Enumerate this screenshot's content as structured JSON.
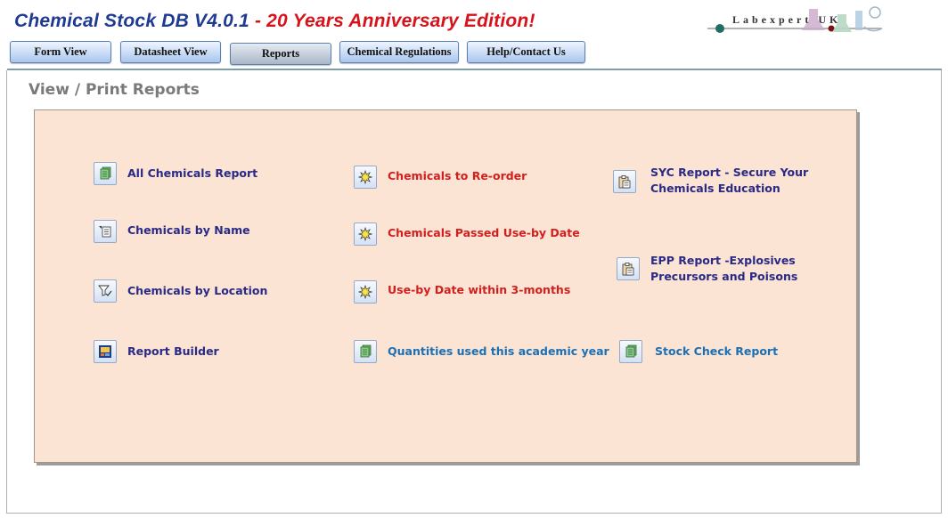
{
  "app": {
    "title_main": "Chemical Stock DB V4.0.1",
    "title_sep": " - ",
    "title_edition": "20 Years Anniversary Edition!",
    "logo_text": "Labexpert UK"
  },
  "nav": {
    "form_view": "Form View",
    "datasheet_view": "Datasheet View",
    "reports": "Reports",
    "chemical_regulations": "Chemical Regulations",
    "help_contact": "Help/Contact Us"
  },
  "page": {
    "heading": "View / Print Reports"
  },
  "reports": {
    "all_chemicals": "All Chemicals Report",
    "by_name": "Chemicals by Name",
    "by_location": "Chemicals by Location",
    "report_builder": "Report Builder",
    "reorder": "Chemicals to Re-order",
    "passed_use_by": "Chemicals Passed Use-by Date",
    "use_by_3_months": "Use-by Date within 3-months",
    "quantities_used": "Quantities used this academic year",
    "syc_line1": "SYC Report - Secure Your",
    "syc_line2": "Chemicals Education",
    "epp_line1": "EPP Report -Explosives",
    "epp_line2": "Precursors and Poisons",
    "stock_check": "Stock Check Report"
  },
  "colors": {
    "title_blue": "#1f3a93",
    "title_red": "#d6121b",
    "panel_bg": "#fbe4d3",
    "label_navy": "#2a2a86",
    "label_red": "#d11f1f",
    "label_blue": "#1b6fb4"
  },
  "icons": {
    "all_chemicals": "report-stack-icon",
    "by_name": "sort-list-icon",
    "by_location": "filter-icon",
    "report_builder": "report-builder-icon",
    "alert": "alert-burst-icon",
    "clipboard": "clipboard-icon"
  }
}
